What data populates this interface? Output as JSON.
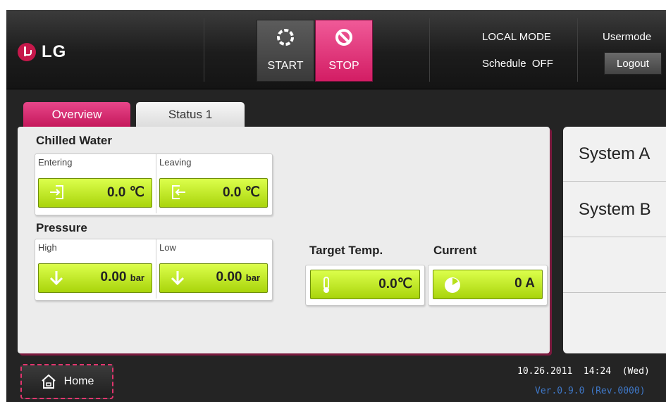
{
  "brand": {
    "name": "LG",
    "color": "#c6184b"
  },
  "controls": {
    "start_label": "START",
    "stop_label": "STOP",
    "stop_color": "#e2356e"
  },
  "status": {
    "mode": "LOCAL MODE",
    "schedule": "Schedule  OFF",
    "user_mode": "Usermode",
    "logout_label": "Logout"
  },
  "tabs": [
    {
      "label": "Overview",
      "active": true
    },
    {
      "label": "Status 1",
      "active": false
    }
  ],
  "chilled_water": {
    "title": "Chilled Water",
    "entering": {
      "label": "Entering",
      "value": "0.0",
      "unit": "℃",
      "icon": "arrow-into-box-icon"
    },
    "leaving": {
      "label": "Leaving",
      "value": "0.0",
      "unit": "℃",
      "icon": "arrow-out-of-box-icon"
    }
  },
  "pressure": {
    "title": "Pressure",
    "high": {
      "label": "High",
      "value": "0.00",
      "unit": "bar",
      "icon": "arrow-down-icon"
    },
    "low": {
      "label": "Low",
      "value": "0.00",
      "unit": "bar",
      "icon": "arrow-down-icon"
    }
  },
  "target_temp": {
    "label": "Target Temp.",
    "value": "0.0",
    "unit": "℃",
    "icon": "thermometer-icon"
  },
  "current": {
    "label": "Current",
    "value": "0",
    "unit": "A",
    "icon": "gauge-icon"
  },
  "systems": [
    {
      "label": "System A"
    },
    {
      "label": "System B"
    }
  ],
  "footer": {
    "home_label": "Home",
    "datetime": "10.26.2011  14:24  (Wed)",
    "version": "Ver.0.9.0 (Rev.0000)"
  },
  "colors": {
    "accent_pink": "#d31d64",
    "value_green": "#b7e01a",
    "version_blue": "#3f78c8"
  }
}
